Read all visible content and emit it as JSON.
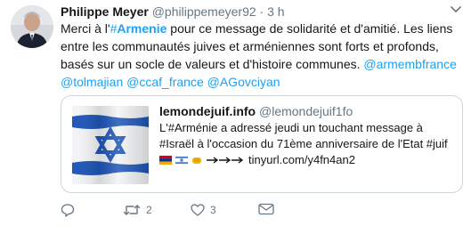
{
  "author": {
    "name": "Philippe Meyer",
    "handle": "@philippemeyer92",
    "separator": "·",
    "time": "3 h"
  },
  "tweet": {
    "p1": "Merci à l'",
    "hashtag_symbol": "#",
    "hashtag_word": "Armenie",
    "p2": " pour ce message de solidarité et d'amitié. Les liens entre les communautés juives et arméniennes sont forts et profonds, basés sur un socle de valeurs et d'histoire communes. ",
    "mention1": "@armembfrance",
    "mention2": "@tolmajian",
    "mention3": "@ccaf_france",
    "mention4": "@AGovciyan"
  },
  "quoted": {
    "name": "lemondejuif.info",
    "handle": "@lemondejuif1fo",
    "line1": "L'#Arménie a adressé jeudi un touchant message à",
    "line2": "#Israël à l'occasion du 71ème anniversaire de l'Etat #juif",
    "link": "tinyurl.com/y4fn4an2"
  },
  "actions": {
    "reply_count": "",
    "retweet_count": "2",
    "like_count": "3"
  },
  "icons": {
    "avatar": "avatar-photo",
    "chevron": "chevron-down-icon",
    "reply": "reply-icon",
    "retweet": "retweet-icon",
    "like": "heart-icon",
    "dm": "mail-icon"
  },
  "colors": {
    "link": "#1da1f2",
    "muted": "#657786",
    "text": "#14171a"
  }
}
